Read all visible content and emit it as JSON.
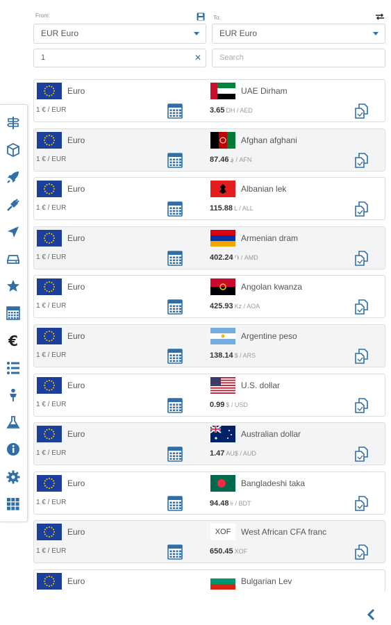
{
  "header": {
    "from_label": "From:",
    "to_label": "To:",
    "from_currency": "EUR Euro",
    "to_currency": "EUR Euro",
    "amount_value": "1",
    "search_placeholder": "Search"
  },
  "colors": {
    "accent": "#2f6ea8",
    "row_alt": "#f3f4f6",
    "border": "#dedede"
  },
  "sidebar": {
    "items": [
      {
        "icon": "signpost-icon"
      },
      {
        "icon": "cube-icon"
      },
      {
        "icon": "rocket-icon"
      },
      {
        "icon": "plug-icon"
      },
      {
        "icon": "location-arrow-icon"
      },
      {
        "icon": "drive-icon"
      },
      {
        "icon": "star-icon"
      },
      {
        "icon": "calculator-icon"
      },
      {
        "icon": "euro-icon",
        "glyph": "€"
      },
      {
        "icon": "list-icon"
      },
      {
        "icon": "person-icon"
      },
      {
        "icon": "flask-icon"
      },
      {
        "icon": "info-icon"
      },
      {
        "icon": "gear-icon"
      },
      {
        "icon": "grid-icon"
      }
    ]
  },
  "rows": [
    {
      "from_name": "Euro",
      "from_rate": "1 € / EUR",
      "to_name": "UAE Dirham",
      "to_value": "3.65",
      "to_unit": "DH / AED",
      "flag": "ae"
    },
    {
      "from_name": "Euro",
      "from_rate": "1 € / EUR",
      "to_name": "Afghan afghani",
      "to_value": "87.46",
      "to_unit": "؋ / AFN",
      "flag": "af"
    },
    {
      "from_name": "Euro",
      "from_rate": "1 € / EUR",
      "to_name": "Albanian lek",
      "to_value": "115.88",
      "to_unit": "L / ALL",
      "flag": "al"
    },
    {
      "from_name": "Euro",
      "from_rate": "1 € / EUR",
      "to_name": "Armenian dram",
      "to_value": "402.24",
      "to_unit": "֏ / AMD",
      "flag": "am"
    },
    {
      "from_name": "Euro",
      "from_rate": "1 € / EUR",
      "to_name": "Angolan kwanza",
      "to_value": "425.93",
      "to_unit": "Kz / AOA",
      "flag": "ao"
    },
    {
      "from_name": "Euro",
      "from_rate": "1 € / EUR",
      "to_name": "Argentine peso",
      "to_value": "138.14",
      "to_unit": "$ / ARS",
      "flag": "ar"
    },
    {
      "from_name": "Euro",
      "from_rate": "1 € / EUR",
      "to_name": "U.S. dollar",
      "to_value": "0.99",
      "to_unit": "$ / USD",
      "flag": "us"
    },
    {
      "from_name": "Euro",
      "from_rate": "1 € / EUR",
      "to_name": "Australian dollar",
      "to_value": "1.47",
      "to_unit": "AU$ / AUD",
      "flag": "au"
    },
    {
      "from_name": "Euro",
      "from_rate": "1 € / EUR",
      "to_name": "Bangladeshi taka",
      "to_value": "94.48",
      "to_unit": "৳ / BDT",
      "flag": "bd"
    },
    {
      "from_name": "Euro",
      "from_rate": "1 € / EUR",
      "to_name": "West African CFA franc",
      "to_value": "650.45",
      "to_unit": "XOF",
      "flag": "xof",
      "flag_text": "XOF"
    },
    {
      "from_name": "Euro",
      "from_rate": "",
      "to_name": "Bulgarian Lev",
      "to_value": "",
      "to_unit": "",
      "flag": "bg"
    }
  ]
}
